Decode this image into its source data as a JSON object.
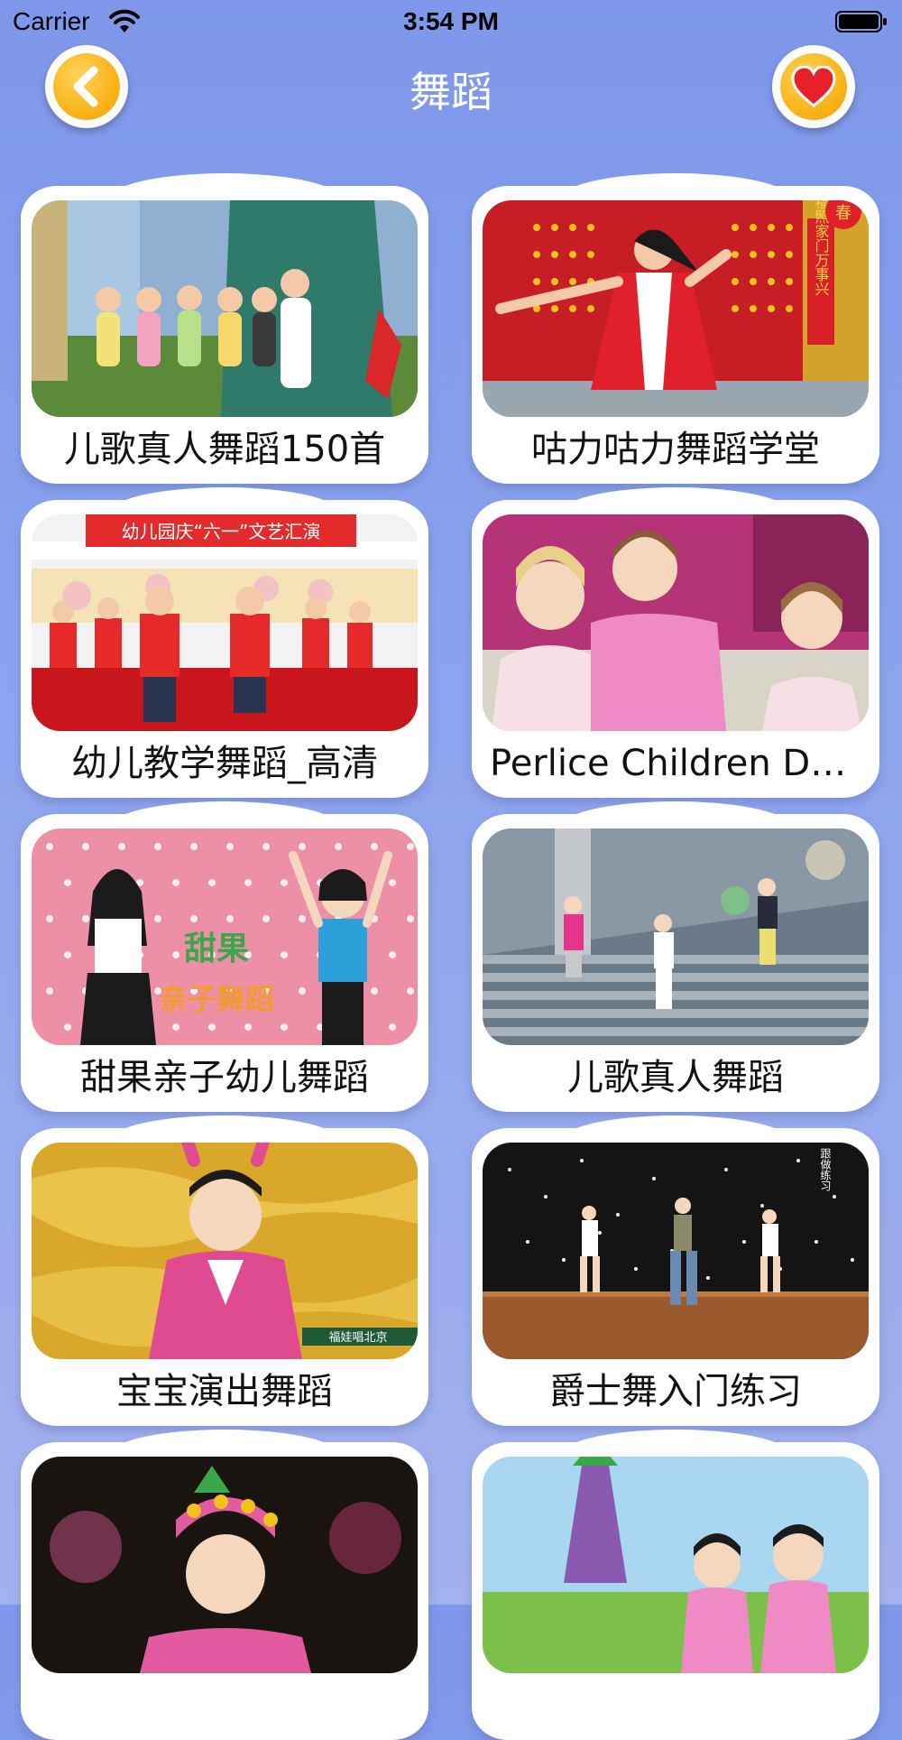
{
  "status_bar": {
    "carrier": "Carrier",
    "time": "3:54 PM"
  },
  "nav": {
    "title": "舞蹈",
    "back_icon": "chevron-left-icon",
    "favorite_icon": "heart-icon",
    "accent_color": "#f9b114"
  },
  "videos": [
    {
      "title": "儿歌真人舞蹈150首"
    },
    {
      "title": "咕力咕力舞蹈学堂"
    },
    {
      "title": "幼儿教学舞蹈_高清"
    },
    {
      "title": "Perlice Children Dance"
    },
    {
      "title": "甜果亲子幼儿舞蹈"
    },
    {
      "title": "儿歌真人舞蹈"
    },
    {
      "title": "宝宝演出舞蹈"
    },
    {
      "title": "爵士舞入门练习"
    },
    {
      "title": ""
    },
    {
      "title": ""
    }
  ],
  "thumbnail_text": {
    "t2_couplet": "福照家门万事兴",
    "t2_banner": "春",
    "t3_banner": "幼儿园庆“六一”文艺汇演",
    "t5_line1": "甜果",
    "t5_line2": "亲子舞蹈",
    "t7_caption": "福娃唱北京",
    "t8_caption": "跟做练习"
  }
}
